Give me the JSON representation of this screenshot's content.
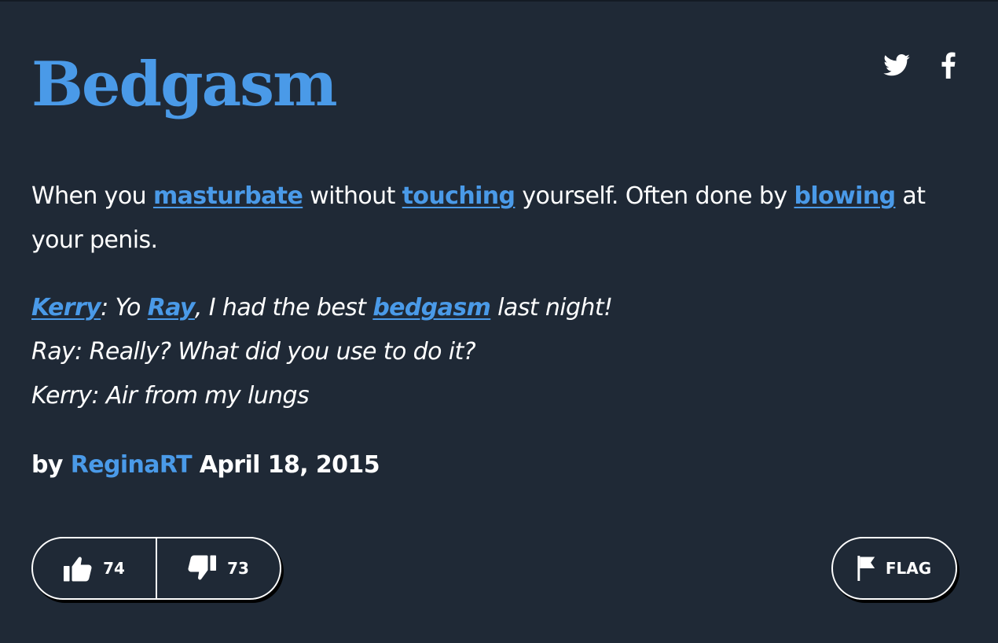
{
  "entry": {
    "word": "Bedgasm",
    "meaning": [
      {
        "text": "When you "
      },
      {
        "text": "masturbate",
        "link": true
      },
      {
        "text": " without "
      },
      {
        "text": "touching",
        "link": true
      },
      {
        "text": " yourself. Often done by "
      },
      {
        "text": "blowing",
        "link": true
      },
      {
        "text": " at your penis."
      }
    ],
    "example_lines": [
      [
        {
          "text": "Kerry",
          "link": true
        },
        {
          "text": ": Yo "
        },
        {
          "text": "Ray",
          "link": true
        },
        {
          "text": ", I had the best "
        },
        {
          "text": "bedgasm",
          "link": true
        },
        {
          "text": " last night!"
        }
      ],
      [
        {
          "text": "Ray: Really? What did you use to do it?"
        }
      ],
      [
        {
          "text": "Kerry: Air from my lungs"
        }
      ]
    ],
    "byline": {
      "prefix": "by",
      "author": "ReginaRT",
      "date": "April 18, 2015"
    }
  },
  "share": {
    "icons": [
      "twitter-icon",
      "facebook-icon"
    ]
  },
  "votes": {
    "up_count": "74",
    "down_count": "73",
    "up_icon": "thumbs-up-icon",
    "down_icon": "thumbs-down-icon"
  },
  "flag": {
    "label": "FLAG",
    "icon": "flag-icon"
  },
  "colors": {
    "background": "#1f2936",
    "accent": "#4a9ae8",
    "text": "#ffffff"
  }
}
